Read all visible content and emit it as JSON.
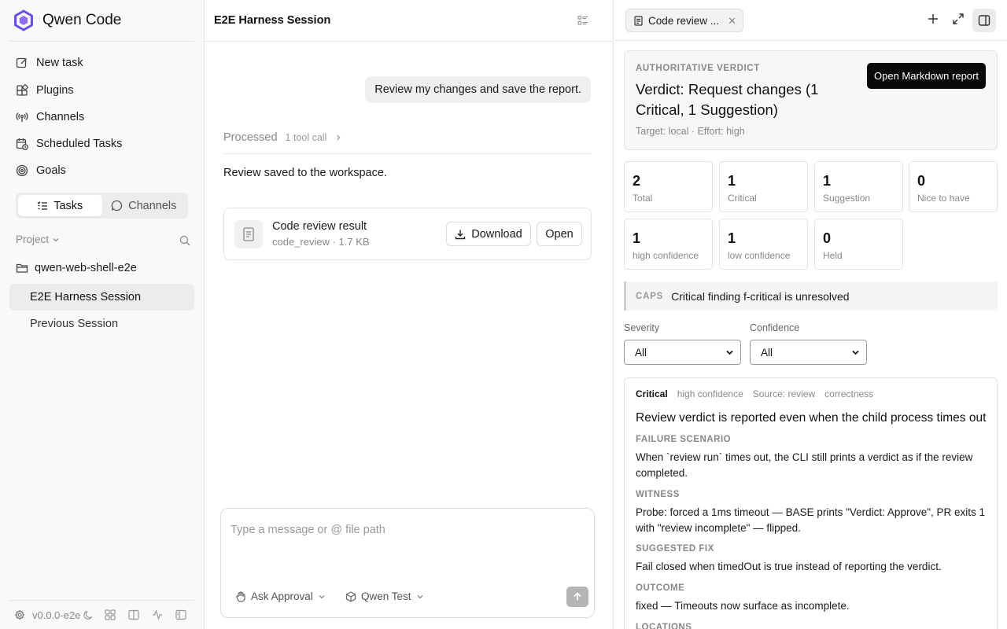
{
  "sidebar": {
    "brand": "Qwen Code",
    "nav": [
      {
        "label": "New task",
        "icon": "edit-icon"
      },
      {
        "label": "Plugins",
        "icon": "puzzle-icon"
      },
      {
        "label": "Channels",
        "icon": "broadcast-icon"
      },
      {
        "label": "Scheduled Tasks",
        "icon": "calendar-clock-icon"
      },
      {
        "label": "Goals",
        "icon": "target-icon"
      }
    ],
    "segments": [
      {
        "label": "Tasks",
        "active": true
      },
      {
        "label": "Channels",
        "active": false
      }
    ],
    "project_label": "Project",
    "folder": "qwen-web-shell-e2e",
    "sessions": [
      {
        "label": "E2E Harness Session",
        "active": true
      },
      {
        "label": "Previous Session",
        "active": false
      }
    ],
    "version": "v0.0.0-e2e"
  },
  "chat": {
    "title": "E2E Harness Session",
    "user_message": "Review my changes and save the report.",
    "processed_label": "Processed",
    "processed_count": "1 tool call",
    "reply": "Review saved to the workspace.",
    "file": {
      "name": "Code review result",
      "meta": "code_review · 1.7 KB",
      "download_label": "Download",
      "open_label": "Open"
    },
    "composer": {
      "placeholder": "Type a message or @ file path",
      "mode": "Ask Approval",
      "model": "Qwen Test"
    }
  },
  "panel": {
    "tab_label": "Code review ...",
    "verdict": {
      "kicker": "AUTHORITATIVE VERDICT",
      "title": "Verdict: Request changes (1 Critical, 1 Suggestion)",
      "meta": "Target: local · Effort: high",
      "button": "Open Markdown report"
    },
    "stats": [
      {
        "value": "2",
        "label": "Total"
      },
      {
        "value": "1",
        "label": "Critical"
      },
      {
        "value": "1",
        "label": "Suggestion"
      },
      {
        "value": "0",
        "label": "Nice to have"
      },
      {
        "value": "1",
        "label": "high confidence"
      },
      {
        "value": "1",
        "label": "low confidence"
      },
      {
        "value": "0",
        "label": "Held"
      }
    ],
    "caps": {
      "tag": "CAPS",
      "text": "Critical finding f-critical is unresolved"
    },
    "filters": {
      "severity_label": "Severity",
      "severity_value": "All",
      "confidence_label": "Confidence",
      "confidence_value": "All"
    },
    "finding": {
      "severity": "Critical",
      "confidence": "high confidence",
      "source": "Source: review",
      "category": "correctness",
      "title": "Review verdict is reported even when the child process times out",
      "failure_label": "FAILURE SCENARIO",
      "failure_text": "When `review run` times out, the CLI still prints a verdict as if the review completed.",
      "witness_label": "WITNESS",
      "witness_text": "Probe: forced a 1ms timeout — BASE prints \"Verdict: Approve\", PR exits 1 with \"review incomplete\" — flipped.",
      "fix_label": "SUGGESTED FIX",
      "fix_text": "Fail closed when timedOut is true instead of reporting the verdict.",
      "outcome_label": "OUTCOME",
      "outcome_text": "fixed — Timeouts now surface as incomplete.",
      "locations_label": "LOCATIONS"
    }
  }
}
